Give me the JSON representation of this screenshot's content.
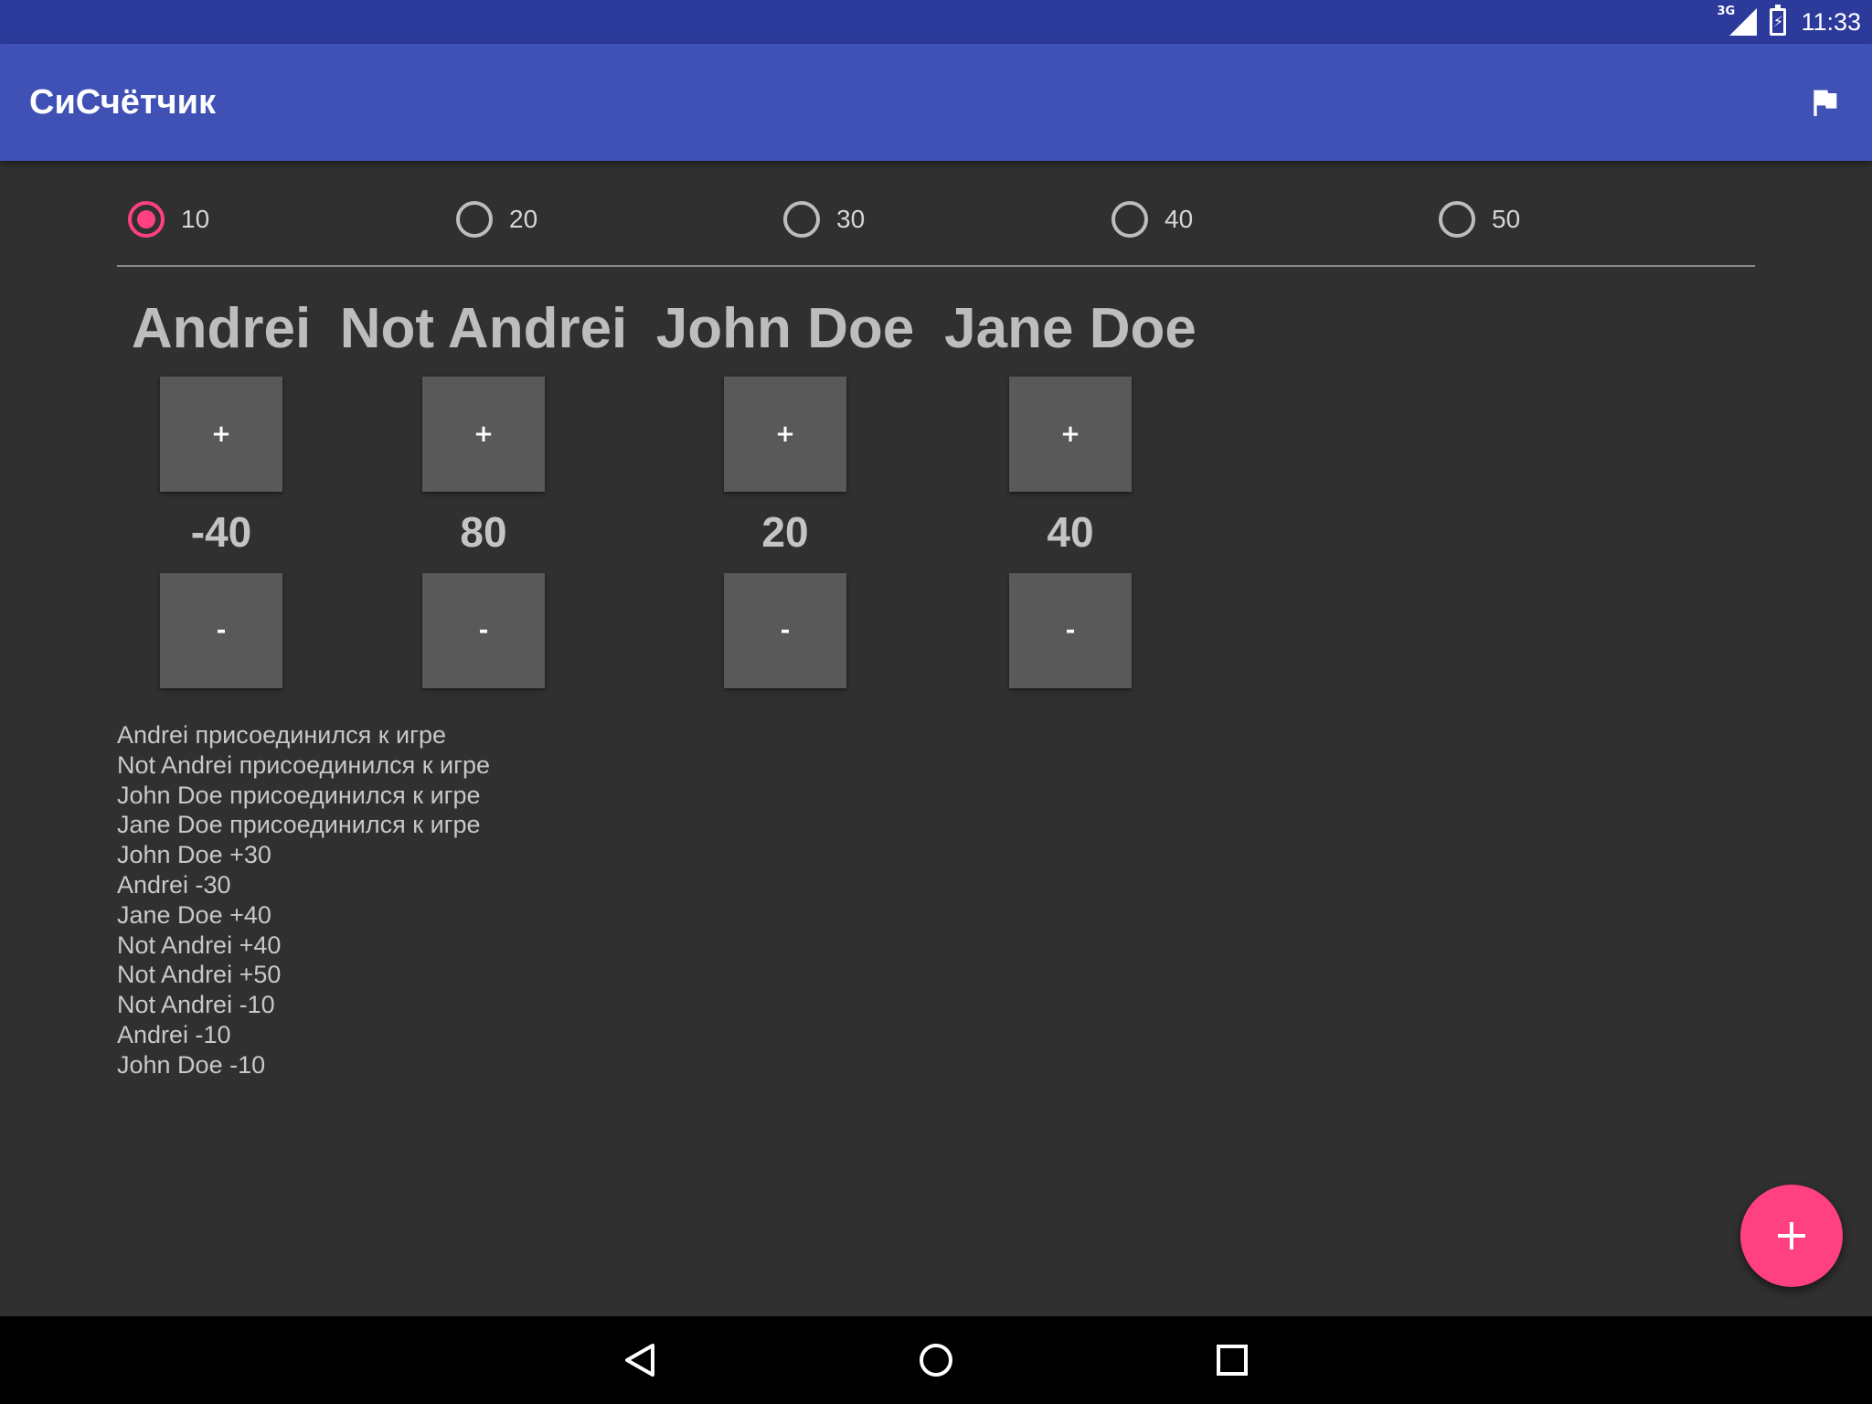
{
  "status_bar": {
    "network": "3G",
    "time": "11:33"
  },
  "app_bar": {
    "title": "СиСчётчик",
    "action_icon": "flag-icon"
  },
  "step_options": [
    {
      "label": "10",
      "checked": true
    },
    {
      "label": "20",
      "checked": false
    },
    {
      "label": "30",
      "checked": false
    },
    {
      "label": "40",
      "checked": false
    },
    {
      "label": "50",
      "checked": false
    }
  ],
  "players": [
    {
      "name": "Andrei",
      "plus_label": "+",
      "score": "-40",
      "minus_label": "-"
    },
    {
      "name": "Not Andrei",
      "plus_label": "+",
      "score": "80",
      "minus_label": "-"
    },
    {
      "name": "John Doe",
      "plus_label": "+",
      "score": "20",
      "minus_label": "-"
    },
    {
      "name": "Jane Doe",
      "plus_label": "+",
      "score": "40",
      "minus_label": "-"
    }
  ],
  "log": [
    "Andrei присоединился к игре",
    "Not Andrei присоединился к игре",
    "John Doe присоединился к игре",
    "Jane Doe присоединился к игре",
    "John Doe +30",
    "Andrei -30",
    "Jane Doe +40",
    "Not Andrei +40",
    "Not Andrei +50",
    "Not Andrei -10",
    "Andrei -10",
    "John Doe -10"
  ],
  "fab": {
    "icon": "plus-icon"
  },
  "nav_bar": {
    "back_icon": "back-icon",
    "home_icon": "home-icon",
    "recents_icon": "recents-icon"
  },
  "colors": {
    "status_bar": "#2c3a9b",
    "app_bar": "#3f51b5",
    "background": "#303030",
    "accent": "#ff4081",
    "button": "#595959"
  }
}
